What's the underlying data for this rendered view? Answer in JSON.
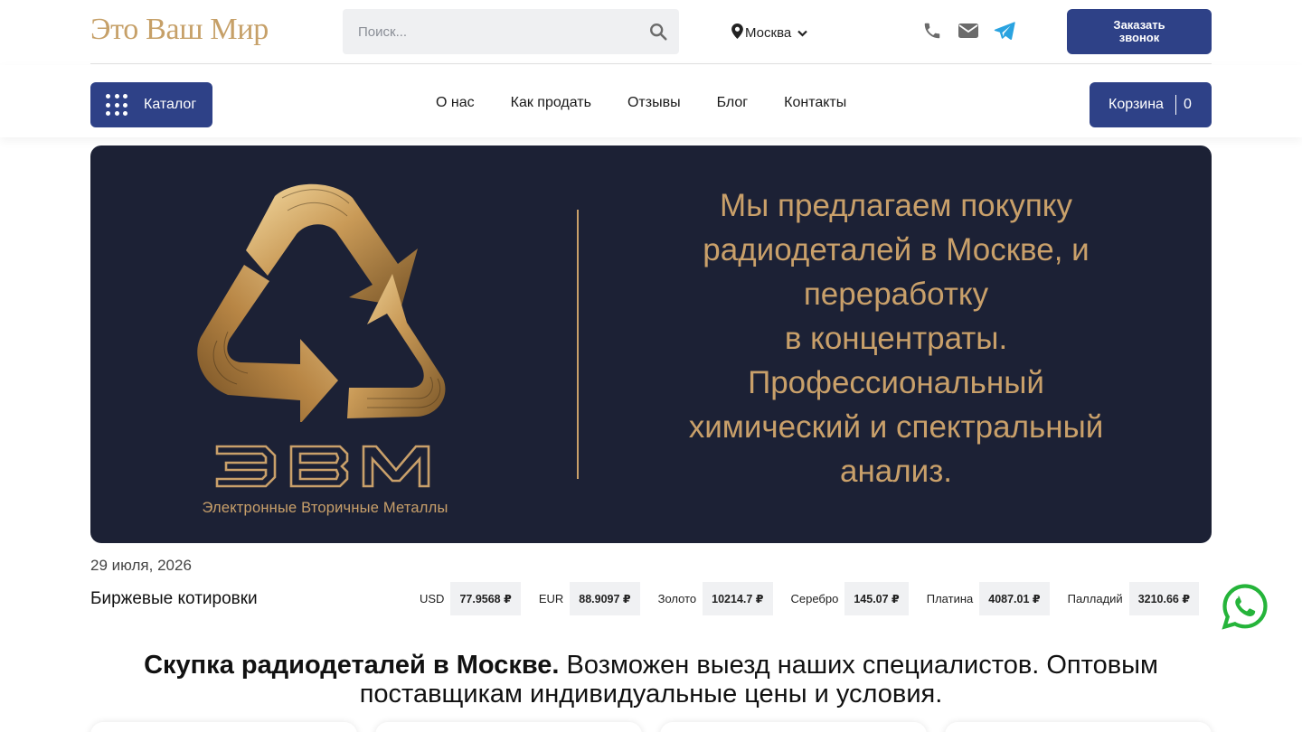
{
  "header": {
    "logo": "Это Ваш Мир",
    "search": {
      "placeholder": "Поиск..."
    },
    "city": "Москва",
    "callback_label": "Заказать\nзвонок"
  },
  "nav": {
    "catalog_label": "Каталог",
    "links": [
      {
        "label": "О нас"
      },
      {
        "label": "Как продать"
      },
      {
        "label": "Отзывы"
      },
      {
        "label": "Блог"
      },
      {
        "label": "Контакты"
      }
    ],
    "cart_label": "Корзина",
    "cart_count": "0"
  },
  "hero": {
    "brand_letters": "ЭВМ",
    "brand_subtitle": "Электронные Вторичные Металлы",
    "headline": "Мы предлагаем покупку\nрадиодеталей в Москве, и\nпереработку\nв концентраты.\nПрофессиональный\nхимический и спектральный\nанализ.",
    "colors": {
      "background": "#1c2135",
      "gold": "#c9a06a"
    }
  },
  "quotes": {
    "date": "29 июля, 2026",
    "title": "Биржевые котировки",
    "items": [
      {
        "label": "USD",
        "value": "77.9568 ₽"
      },
      {
        "label": "EUR",
        "value": "88.9097 ₽"
      },
      {
        "label": "Золото",
        "value": "10214.7 ₽"
      },
      {
        "label": "Серебро",
        "value": "145.07 ₽"
      },
      {
        "label": "Платина",
        "value": "4087.01 ₽"
      },
      {
        "label": "Палладий",
        "value": "3210.66 ₽"
      }
    ]
  },
  "main": {
    "headline_bold": "Скупка радиодеталей в Москве.",
    "headline_rest": " Возможен выезд наших специалистов. Оптовым поставщикам индивидуальные цены и условия."
  },
  "icons": {
    "search": "search-icon",
    "location": "location-pin-icon",
    "chevron": "chevron-down-icon",
    "phone": "phone-icon",
    "mail": "mail-icon",
    "telegram": "telegram-icon",
    "catalog": "grid-dots-icon",
    "whatsapp": "whatsapp-icon",
    "recycle": "recycle-logo-icon"
  },
  "colors": {
    "primary": "#2e4187",
    "logo_gold": "#c6a068",
    "icon_gray": "#6b6b6b",
    "telegram": "#2aa3e0",
    "whatsapp": "#25b43a"
  }
}
